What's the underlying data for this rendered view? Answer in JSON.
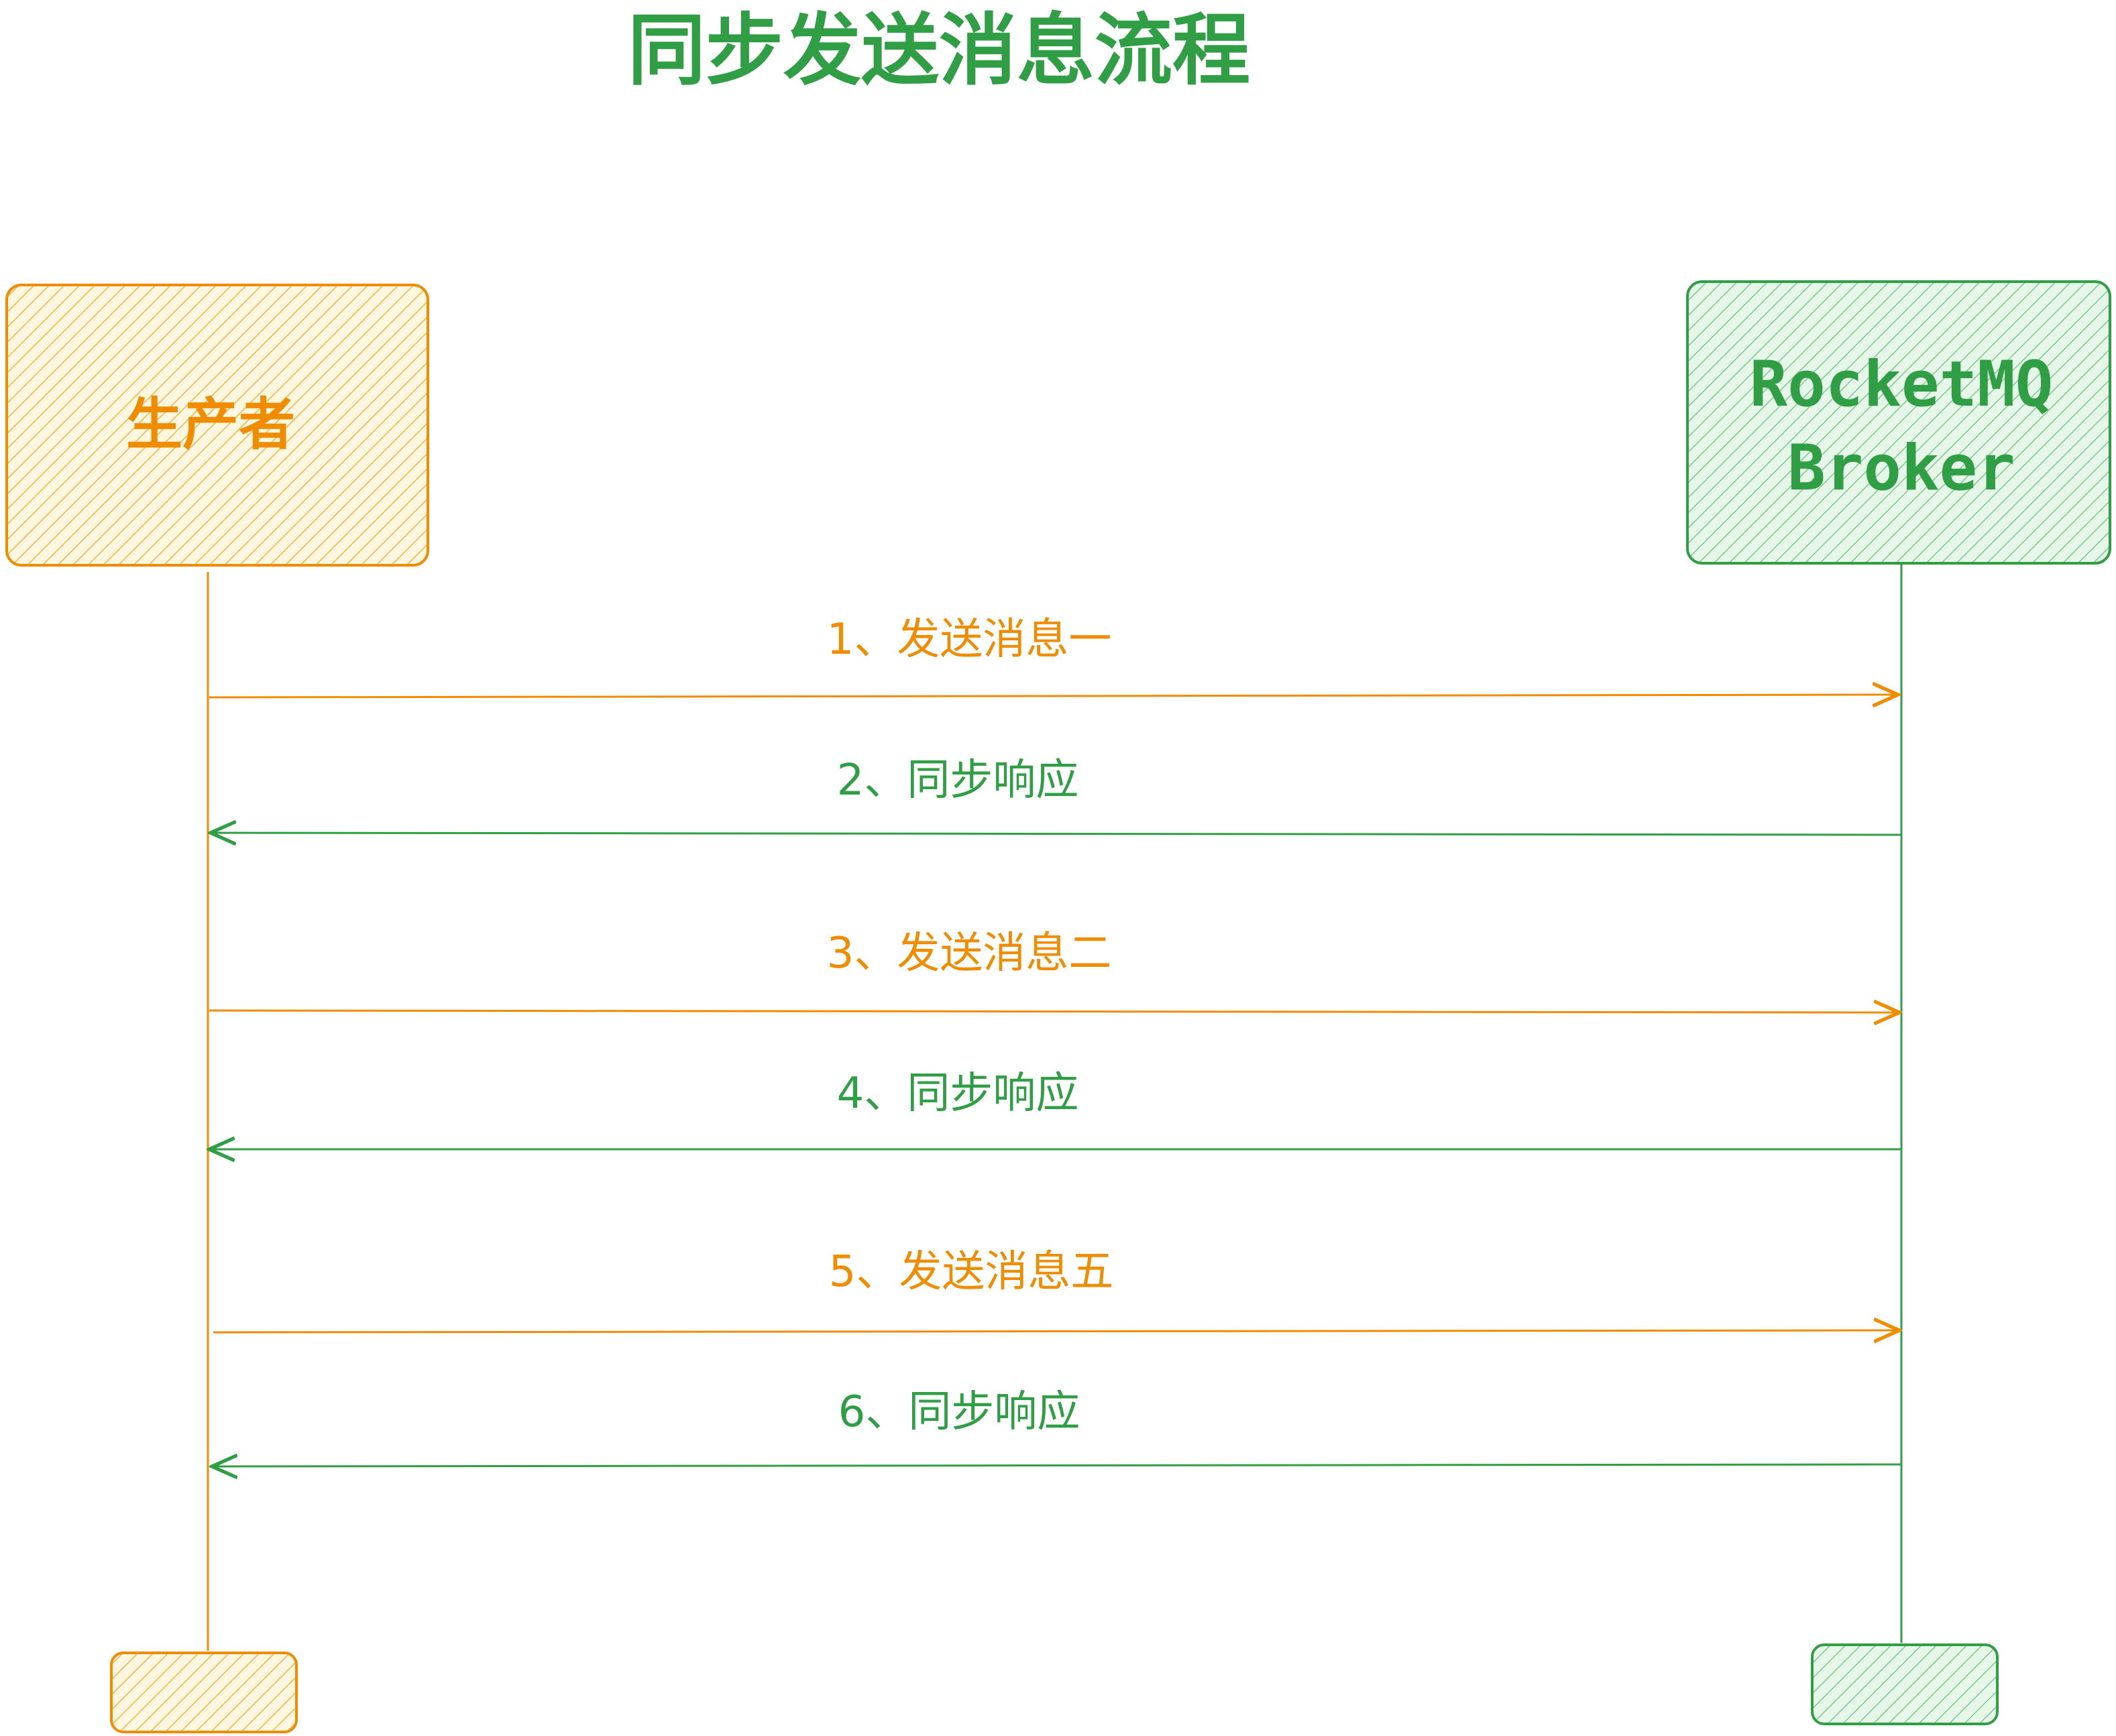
{
  "title": "同步发送消息流程",
  "participants": {
    "producer": {
      "label": "生产者",
      "color": "#f08c00"
    },
    "broker": {
      "line1": "RocketMQ",
      "line2": "Broker",
      "color": "#2f9e44"
    }
  },
  "messages": [
    {
      "label": "1、发送消息一",
      "direction": "to-broker",
      "color": "#f08c00"
    },
    {
      "label": "2、同步响应",
      "direction": "to-producer",
      "color": "#2f9e44"
    },
    {
      "label": "3、发送消息二",
      "direction": "to-broker",
      "color": "#f08c00"
    },
    {
      "label": "4、同步响应",
      "direction": "to-producer",
      "color": "#2f9e44"
    },
    {
      "label": "5、发送消息五",
      "direction": "to-broker",
      "color": "#f08c00"
    },
    {
      "label": "6、同步响应",
      "direction": "to-producer",
      "color": "#2f9e44"
    }
  ],
  "colors": {
    "orange": "#f08c00",
    "orange_fill": "#ffec99",
    "green": "#2f9e44",
    "green_fill": "#b2f2bb"
  }
}
